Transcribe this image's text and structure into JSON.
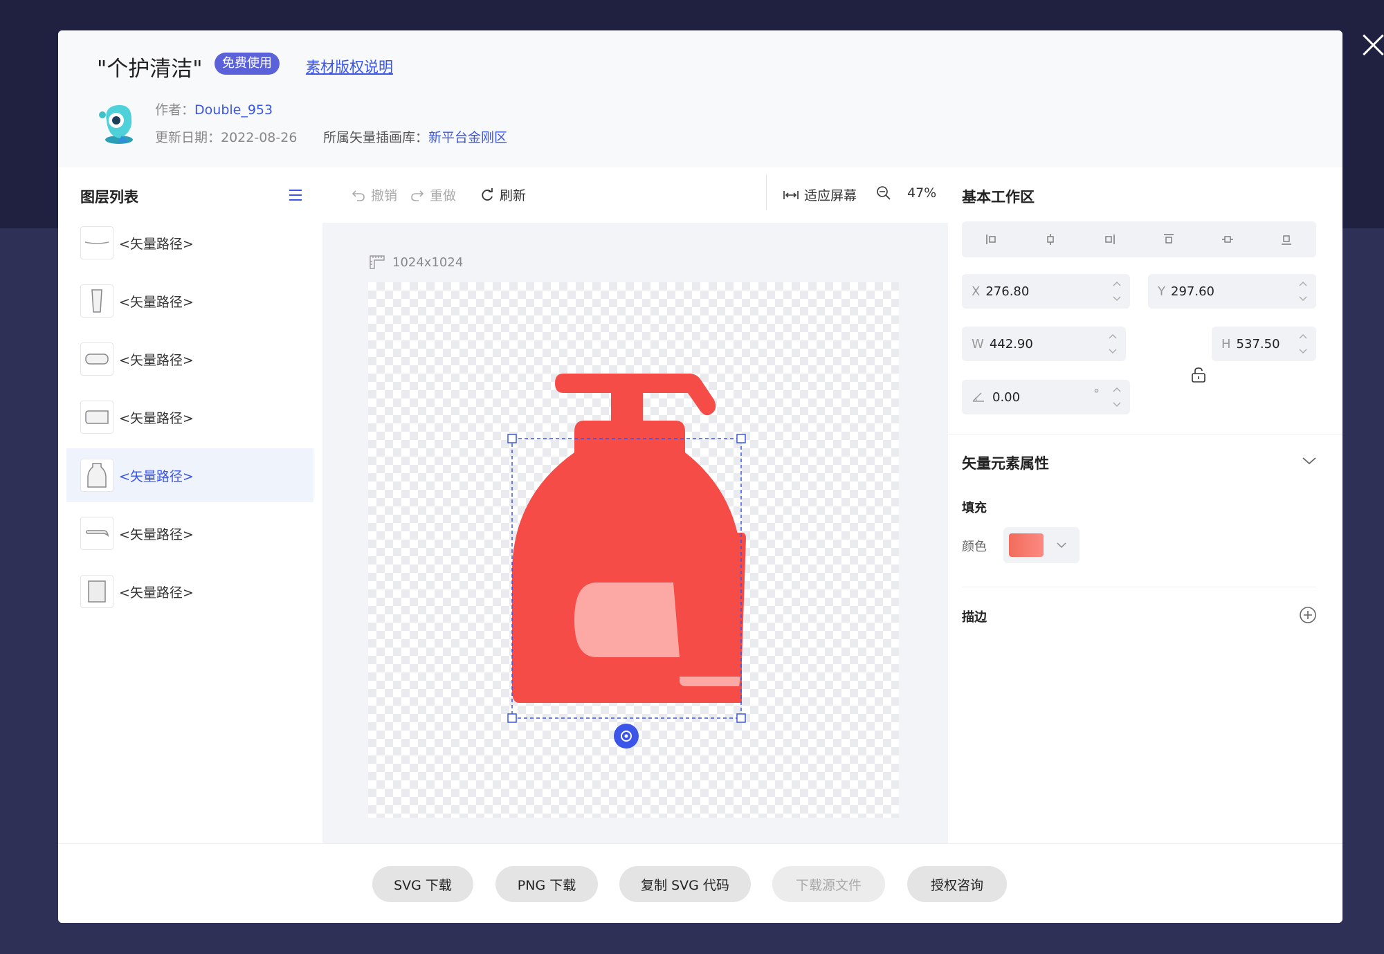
{
  "modal": {
    "title": "\"个护清洁\"",
    "badge": "免费使用",
    "copyright_link": "素材版权说明",
    "author_label": "作者：",
    "author_name": "Double_953",
    "date_label": "更新日期：2022-08-26",
    "library_label": "所属矢量插画库：",
    "library_name": "新平台金刚区"
  },
  "layers": {
    "title": "图层列表",
    "items": [
      {
        "label": "<矢量路径>",
        "thumb": "thin-line"
      },
      {
        "label": "<矢量路径>",
        "thumb": "tall-cup"
      },
      {
        "label": "<矢量路径>",
        "thumb": "rounded-rect"
      },
      {
        "label": "<矢量路径>",
        "thumb": "tag-shape"
      },
      {
        "label": "<矢量路径>",
        "thumb": "bottle-shape",
        "active": true
      },
      {
        "label": "<矢量路径>",
        "thumb": "pump-nozzle"
      },
      {
        "label": "<矢量路径>",
        "thumb": "rectangle"
      }
    ]
  },
  "toolbar": {
    "undo": "撤销",
    "redo": "重做",
    "refresh": "刷新",
    "fit_screen": "适应屏幕",
    "zoom": "47%"
  },
  "canvas": {
    "size": "1024x1024"
  },
  "workspace": {
    "title": "基本工作区",
    "x_label": "X",
    "x_value": "276.80",
    "y_label": "Y",
    "y_value": "297.60",
    "w_label": "W",
    "w_value": "442.90",
    "h_label": "H",
    "h_value": "537.50",
    "angle_value": "0.00",
    "degree": "°"
  },
  "properties": {
    "title": "矢量元素属性",
    "fill_label": "填充",
    "color_label": "颜色",
    "stroke_label": "描边",
    "fill_color": "#f54c48"
  },
  "footer": {
    "svg_download": "SVG 下载",
    "png_download": "PNG 下载",
    "copy_svg": "复制 SVG 代码",
    "download_source": "下载源文件",
    "license": "授权咨询"
  }
}
